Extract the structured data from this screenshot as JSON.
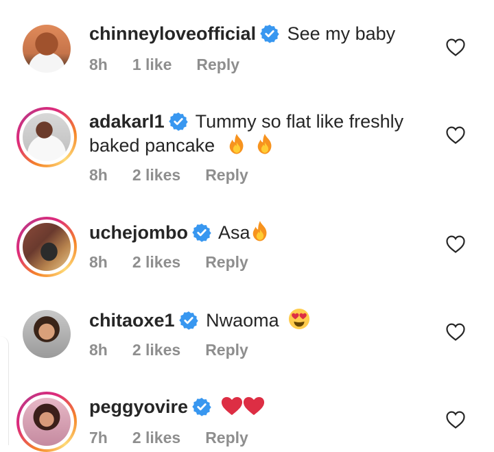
{
  "comments": [
    {
      "username": "chinneyloveofficial",
      "text": "See my baby",
      "time": "8h",
      "likes": "1 like",
      "reply": "Reply"
    },
    {
      "username": "adakarl1",
      "text": "Tummy so flat like freshly",
      "text2": "baked pancake",
      "time": "8h",
      "likes": "2 likes",
      "reply": "Reply"
    },
    {
      "username": "uchejombo",
      "text": "Asa",
      "time": "8h",
      "likes": "2 likes",
      "reply": "Reply"
    },
    {
      "username": "chitaoxe1",
      "text": "Nwaoma",
      "time": "8h",
      "likes": "2 likes",
      "reply": "Reply"
    },
    {
      "username": "peggyovire",
      "text": "",
      "time": "7h",
      "likes": "2 likes",
      "reply": "Reply"
    }
  ],
  "icons": {
    "verified": "verified-badge-icon",
    "like": "heart-outline-icon",
    "fire": "fire-emoji",
    "heart_eyes": "heart-eyes-emoji",
    "red_heart": "red-heart-emoji"
  },
  "colors": {
    "verified_blue": "#3897f0",
    "meta_gray": "#8e8e8e",
    "text": "#262626"
  }
}
